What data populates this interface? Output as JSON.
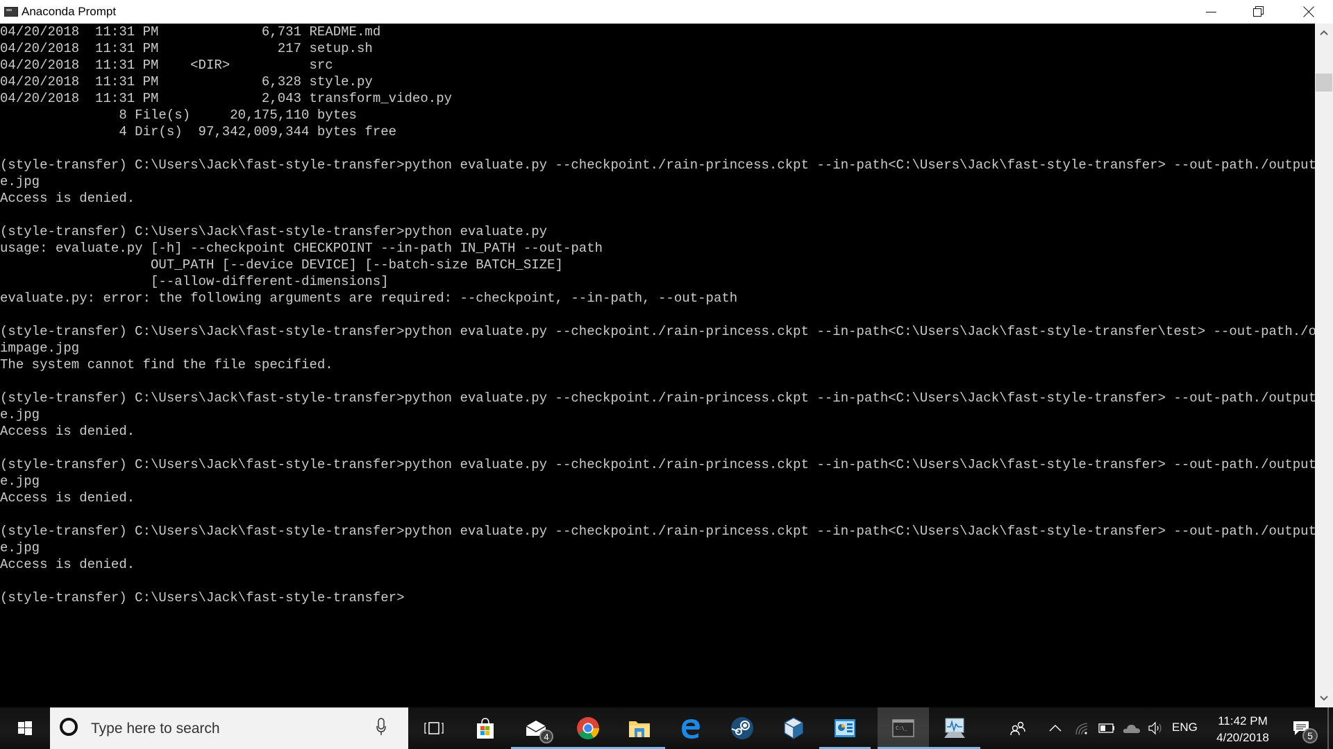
{
  "window": {
    "title": "Anaconda Prompt",
    "controls": {
      "minimize": "Minimize",
      "maximize": "Restore Down",
      "close": "Close"
    }
  },
  "terminal": {
    "lines": [
      "04/20/2018  11:31 PM             6,731 README.md",
      "04/20/2018  11:31 PM               217 setup.sh",
      "04/20/2018  11:31 PM    <DIR>          src",
      "04/20/2018  11:31 PM             6,328 style.py",
      "04/20/2018  11:31 PM             2,043 transform_video.py",
      "               8 File(s)     20,175,110 bytes",
      "               4 Dir(s)  97,342,009,344 bytes free",
      "",
      "(style-transfer) C:\\Users\\Jack\\fast-style-transfer>python evaluate.py --checkpoint./rain-princess.ckpt --in-path<C:\\Users\\Jack\\fast-style-transfer> --out-path./output_impag",
      "e.jpg",
      "Access is denied.",
      "",
      "(style-transfer) C:\\Users\\Jack\\fast-style-transfer>python evaluate.py",
      "usage: evaluate.py [-h] --checkpoint CHECKPOINT --in-path IN_PATH --out-path",
      "                   OUT_PATH [--device DEVICE] [--batch-size BATCH_SIZE]",
      "                   [--allow-different-dimensions]",
      "evaluate.py: error: the following arguments are required: --checkpoint, --in-path, --out-path",
      "",
      "(style-transfer) C:\\Users\\Jack\\fast-style-transfer>python evaluate.py --checkpoint./rain-princess.ckpt --in-path<C:\\Users\\Jack\\fast-style-transfer\\test> --out-path./output_",
      "impage.jpg",
      "The system cannot find the file specified.",
      "",
      "(style-transfer) C:\\Users\\Jack\\fast-style-transfer>python evaluate.py --checkpoint./rain-princess.ckpt --in-path<C:\\Users\\Jack\\fast-style-transfer> --out-path./output_impag",
      "e.jpg",
      "Access is denied.",
      "",
      "(style-transfer) C:\\Users\\Jack\\fast-style-transfer>python evaluate.py --checkpoint./rain-princess.ckpt --in-path<C:\\Users\\Jack\\fast-style-transfer> --out-path./output_impag",
      "e.jpg",
      "Access is denied.",
      "",
      "(style-transfer) C:\\Users\\Jack\\fast-style-transfer>python evaluate.py --checkpoint./rain-princess.ckpt --in-path<C:\\Users\\Jack\\fast-style-transfer> --out-path./output_impag",
      "e.jpg",
      "Access is denied.",
      "",
      "(style-transfer) C:\\Users\\Jack\\fast-style-transfer>"
    ],
    "text_color": "#cccccc",
    "background": "#000000"
  },
  "taskbar": {
    "search_placeholder": "Type here to search",
    "apps": [
      {
        "name": "task-view",
        "icon": "task-view-icon"
      },
      {
        "name": "microsoft-store",
        "icon": "store-icon"
      },
      {
        "name": "mail",
        "icon": "mail-icon",
        "badge": "4"
      },
      {
        "name": "chrome",
        "icon": "chrome-icon"
      },
      {
        "name": "file-explorer",
        "icon": "folder-icon"
      },
      {
        "name": "edge",
        "icon": "edge-icon"
      },
      {
        "name": "steam",
        "icon": "steam-icon"
      },
      {
        "name": "virtualbox",
        "icon": "virtualbox-icon"
      },
      {
        "name": "control-panel",
        "icon": "control-panel-icon"
      },
      {
        "name": "anaconda-prompt",
        "icon": "terminal-icon"
      },
      {
        "name": "resource-monitor",
        "icon": "monitor-icon"
      }
    ],
    "tray": {
      "language": "ENG",
      "time": "11:42 PM",
      "date": "4/20/2018",
      "notifications_count": "5"
    },
    "accent": "#76b9ed"
  }
}
